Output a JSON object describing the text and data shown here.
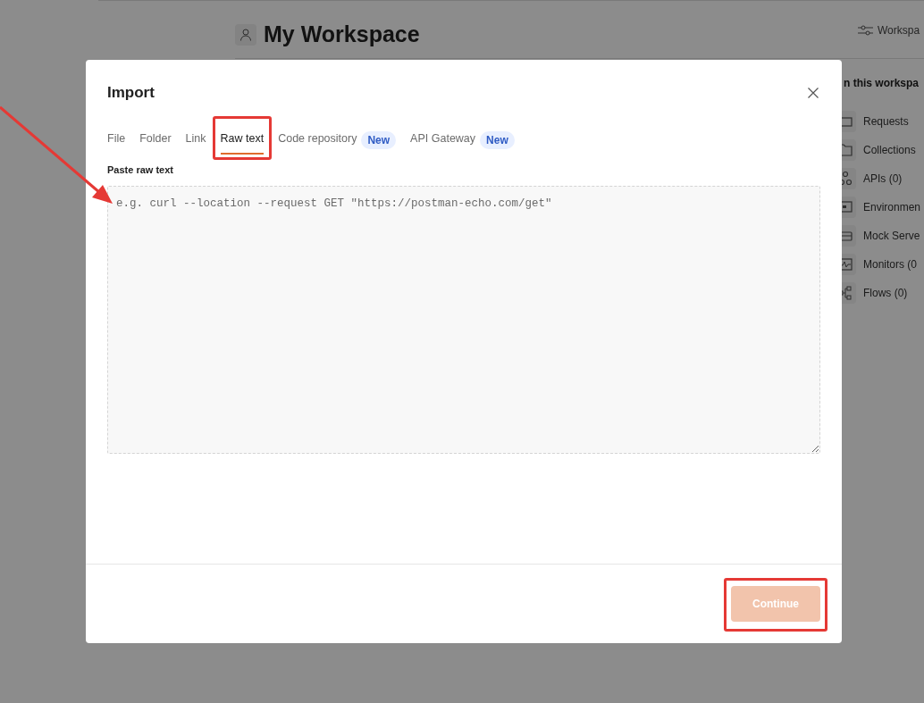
{
  "workspace": {
    "title": "My Workspace",
    "settings_label": "Workspa",
    "panel_title": "n this workspa",
    "items": [
      {
        "kind": "requests",
        "label": "Requests"
      },
      {
        "kind": "collections",
        "label": "Collections"
      },
      {
        "kind": "apis",
        "label": "APIs (0)"
      },
      {
        "kind": "environments",
        "label": "Environmen"
      },
      {
        "kind": "mock",
        "label": "Mock Serve"
      },
      {
        "kind": "monitors",
        "label": "Monitors (0"
      },
      {
        "kind": "flows",
        "label": "Flows (0)"
      }
    ]
  },
  "dialog": {
    "title": "Import",
    "tabs": [
      {
        "label": "File",
        "selected": false
      },
      {
        "label": "Folder",
        "selected": false
      },
      {
        "label": "Link",
        "selected": false
      },
      {
        "label": "Raw text",
        "selected": true
      },
      {
        "label": "Code repository",
        "selected": false,
        "badge": "New"
      },
      {
        "label": "API Gateway",
        "selected": false,
        "badge": "New"
      }
    ],
    "field_label": "Paste raw text",
    "textarea": {
      "placeholder": "e.g. curl --location --request GET \"https://postman-echo.com/get\""
    },
    "continue_button": {
      "label": "Continue",
      "disabled": true
    }
  }
}
